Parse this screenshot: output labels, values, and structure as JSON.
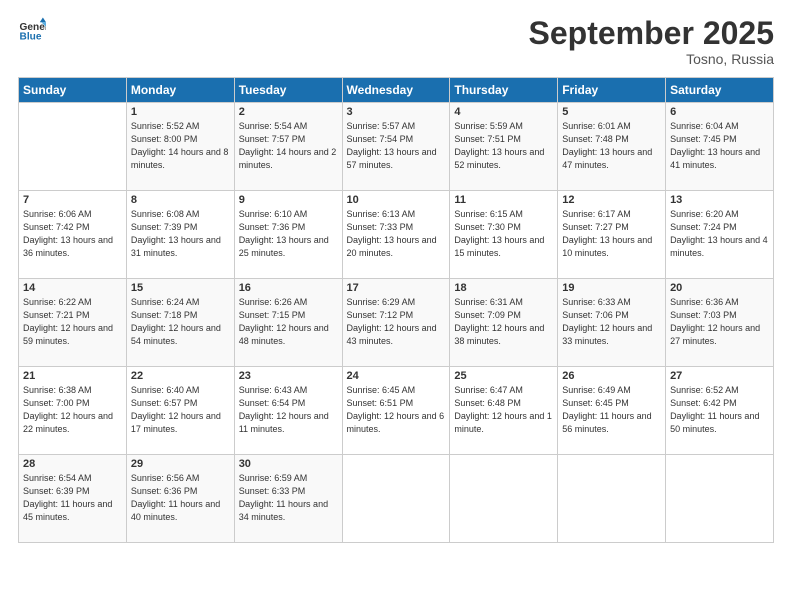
{
  "logo": {
    "line1": "General",
    "line2": "Blue"
  },
  "title": "September 2025",
  "subtitle": "Tosno, Russia",
  "headers": [
    "Sunday",
    "Monday",
    "Tuesday",
    "Wednesday",
    "Thursday",
    "Friday",
    "Saturday"
  ],
  "weeks": [
    [
      {
        "day": "",
        "sunrise": "",
        "sunset": "",
        "daylight": ""
      },
      {
        "day": "1",
        "sunrise": "Sunrise: 5:52 AM",
        "sunset": "Sunset: 8:00 PM",
        "daylight": "Daylight: 14 hours and 8 minutes."
      },
      {
        "day": "2",
        "sunrise": "Sunrise: 5:54 AM",
        "sunset": "Sunset: 7:57 PM",
        "daylight": "Daylight: 14 hours and 2 minutes."
      },
      {
        "day": "3",
        "sunrise": "Sunrise: 5:57 AM",
        "sunset": "Sunset: 7:54 PM",
        "daylight": "Daylight: 13 hours and 57 minutes."
      },
      {
        "day": "4",
        "sunrise": "Sunrise: 5:59 AM",
        "sunset": "Sunset: 7:51 PM",
        "daylight": "Daylight: 13 hours and 52 minutes."
      },
      {
        "day": "5",
        "sunrise": "Sunrise: 6:01 AM",
        "sunset": "Sunset: 7:48 PM",
        "daylight": "Daylight: 13 hours and 47 minutes."
      },
      {
        "day": "6",
        "sunrise": "Sunrise: 6:04 AM",
        "sunset": "Sunset: 7:45 PM",
        "daylight": "Daylight: 13 hours and 41 minutes."
      }
    ],
    [
      {
        "day": "7",
        "sunrise": "Sunrise: 6:06 AM",
        "sunset": "Sunset: 7:42 PM",
        "daylight": "Daylight: 13 hours and 36 minutes."
      },
      {
        "day": "8",
        "sunrise": "Sunrise: 6:08 AM",
        "sunset": "Sunset: 7:39 PM",
        "daylight": "Daylight: 13 hours and 31 minutes."
      },
      {
        "day": "9",
        "sunrise": "Sunrise: 6:10 AM",
        "sunset": "Sunset: 7:36 PM",
        "daylight": "Daylight: 13 hours and 25 minutes."
      },
      {
        "day": "10",
        "sunrise": "Sunrise: 6:13 AM",
        "sunset": "Sunset: 7:33 PM",
        "daylight": "Daylight: 13 hours and 20 minutes."
      },
      {
        "day": "11",
        "sunrise": "Sunrise: 6:15 AM",
        "sunset": "Sunset: 7:30 PM",
        "daylight": "Daylight: 13 hours and 15 minutes."
      },
      {
        "day": "12",
        "sunrise": "Sunrise: 6:17 AM",
        "sunset": "Sunset: 7:27 PM",
        "daylight": "Daylight: 13 hours and 10 minutes."
      },
      {
        "day": "13",
        "sunrise": "Sunrise: 6:20 AM",
        "sunset": "Sunset: 7:24 PM",
        "daylight": "Daylight: 13 hours and 4 minutes."
      }
    ],
    [
      {
        "day": "14",
        "sunrise": "Sunrise: 6:22 AM",
        "sunset": "Sunset: 7:21 PM",
        "daylight": "Daylight: 12 hours and 59 minutes."
      },
      {
        "day": "15",
        "sunrise": "Sunrise: 6:24 AM",
        "sunset": "Sunset: 7:18 PM",
        "daylight": "Daylight: 12 hours and 54 minutes."
      },
      {
        "day": "16",
        "sunrise": "Sunrise: 6:26 AM",
        "sunset": "Sunset: 7:15 PM",
        "daylight": "Daylight: 12 hours and 48 minutes."
      },
      {
        "day": "17",
        "sunrise": "Sunrise: 6:29 AM",
        "sunset": "Sunset: 7:12 PM",
        "daylight": "Daylight: 12 hours and 43 minutes."
      },
      {
        "day": "18",
        "sunrise": "Sunrise: 6:31 AM",
        "sunset": "Sunset: 7:09 PM",
        "daylight": "Daylight: 12 hours and 38 minutes."
      },
      {
        "day": "19",
        "sunrise": "Sunrise: 6:33 AM",
        "sunset": "Sunset: 7:06 PM",
        "daylight": "Daylight: 12 hours and 33 minutes."
      },
      {
        "day": "20",
        "sunrise": "Sunrise: 6:36 AM",
        "sunset": "Sunset: 7:03 PM",
        "daylight": "Daylight: 12 hours and 27 minutes."
      }
    ],
    [
      {
        "day": "21",
        "sunrise": "Sunrise: 6:38 AM",
        "sunset": "Sunset: 7:00 PM",
        "daylight": "Daylight: 12 hours and 22 minutes."
      },
      {
        "day": "22",
        "sunrise": "Sunrise: 6:40 AM",
        "sunset": "Sunset: 6:57 PM",
        "daylight": "Daylight: 12 hours and 17 minutes."
      },
      {
        "day": "23",
        "sunrise": "Sunrise: 6:43 AM",
        "sunset": "Sunset: 6:54 PM",
        "daylight": "Daylight: 12 hours and 11 minutes."
      },
      {
        "day": "24",
        "sunrise": "Sunrise: 6:45 AM",
        "sunset": "Sunset: 6:51 PM",
        "daylight": "Daylight: 12 hours and 6 minutes."
      },
      {
        "day": "25",
        "sunrise": "Sunrise: 6:47 AM",
        "sunset": "Sunset: 6:48 PM",
        "daylight": "Daylight: 12 hours and 1 minute."
      },
      {
        "day": "26",
        "sunrise": "Sunrise: 6:49 AM",
        "sunset": "Sunset: 6:45 PM",
        "daylight": "Daylight: 11 hours and 56 minutes."
      },
      {
        "day": "27",
        "sunrise": "Sunrise: 6:52 AM",
        "sunset": "Sunset: 6:42 PM",
        "daylight": "Daylight: 11 hours and 50 minutes."
      }
    ],
    [
      {
        "day": "28",
        "sunrise": "Sunrise: 6:54 AM",
        "sunset": "Sunset: 6:39 PM",
        "daylight": "Daylight: 11 hours and 45 minutes."
      },
      {
        "day": "29",
        "sunrise": "Sunrise: 6:56 AM",
        "sunset": "Sunset: 6:36 PM",
        "daylight": "Daylight: 11 hours and 40 minutes."
      },
      {
        "day": "30",
        "sunrise": "Sunrise: 6:59 AM",
        "sunset": "Sunset: 6:33 PM",
        "daylight": "Daylight: 11 hours and 34 minutes."
      },
      {
        "day": "",
        "sunrise": "",
        "sunset": "",
        "daylight": ""
      },
      {
        "day": "",
        "sunrise": "",
        "sunset": "",
        "daylight": ""
      },
      {
        "day": "",
        "sunrise": "",
        "sunset": "",
        "daylight": ""
      },
      {
        "day": "",
        "sunrise": "",
        "sunset": "",
        "daylight": ""
      }
    ]
  ]
}
